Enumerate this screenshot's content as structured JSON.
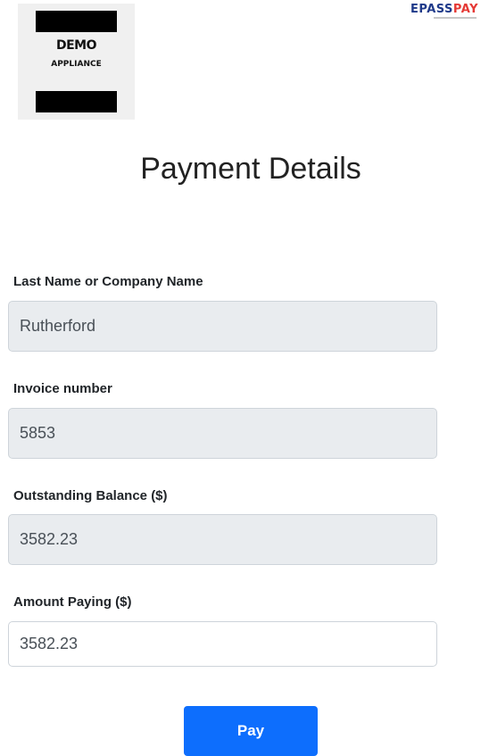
{
  "logo": {
    "line1": "DEMO",
    "line2": "APPLIANCE"
  },
  "brand": {
    "part1": "EPASS",
    "part2": "PAY"
  },
  "page": {
    "title": "Payment Details"
  },
  "form": {
    "last_name": {
      "label": "Last Name or Company Name",
      "value": "Rutherford"
    },
    "invoice_number": {
      "label": "Invoice number",
      "value": "5853"
    },
    "outstanding_balance": {
      "label": "Outstanding Balance ($)",
      "value": "3582.23"
    },
    "amount_paying": {
      "label": "Amount Paying ($)",
      "value": "3582.23"
    },
    "submit_label": "Pay"
  },
  "colors": {
    "primary": "#0d6efd",
    "readonly_field": "#e9ecef",
    "brand_blue": "#1f3a8a",
    "brand_red": "#e53935"
  }
}
